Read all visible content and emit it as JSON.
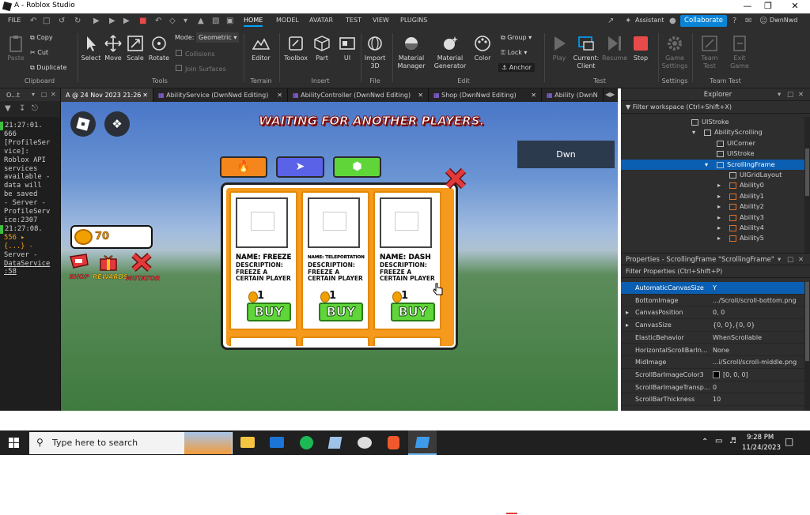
{
  "window": {
    "title": "A - Roblox Studio",
    "controls": [
      "—",
      "❐",
      "✕"
    ]
  },
  "menu": {
    "items": [
      "FILE",
      "HOME",
      "MODEL",
      "AVATAR",
      "TEST",
      "VIEW",
      "PLUGINS"
    ],
    "active": "HOME",
    "assistant": "Assistant",
    "collaborate": "Collaborate",
    "user": "DwnNwd"
  },
  "ribbon": {
    "clipboard": {
      "paste": "Paste",
      "copy": "Copy",
      "cut": "Cut",
      "duplicate": "Duplicate",
      "label": "Clipboard"
    },
    "tools": {
      "select": "Select",
      "move": "Move",
      "scale": "Scale",
      "rotate": "Rotate",
      "mode_label": "Mode:",
      "mode_value": "Geometric",
      "collisions": "Collisions",
      "join_surfaces": "Join Surfaces",
      "label": "Tools"
    },
    "terrain": {
      "editor": "Editor",
      "label": "Terrain"
    },
    "insert": {
      "toolbox": "Toolbox",
      "part": "Part",
      "ui": "UI",
      "label": "Insert"
    },
    "file": {
      "import3d_1": "Import",
      "import3d_2": "3D",
      "label": "File"
    },
    "edit": {
      "material_manager_1": "Material",
      "material_manager_2": "Manager",
      "material_generator_1": "Material",
      "material_generator_2": "Generator",
      "color": "Color",
      "group": "Group",
      "lock": "Lock",
      "anchor": "Anchor",
      "label": "Edit"
    },
    "test": {
      "play": "Play",
      "current_client_1": "Current:",
      "current_client_2": "Client",
      "resume": "Resume",
      "stop": "Stop",
      "label": "Test"
    },
    "settings": {
      "game_settings_1": "Game",
      "game_settings_2": "Settings",
      "label": "Settings"
    },
    "team_test": {
      "team_test_1": "Team",
      "team_test_2": "Test",
      "exit_game_1": "Exit",
      "exit_game_2": "Game",
      "label": "Team Test"
    }
  },
  "output": {
    "title": "O...t",
    "lines": [
      "21:27:01.",
      "666",
      "[ProfileSer",
      "vice]:",
      "Roblox API",
      "services",
      "available -",
      "data will",
      "be saved",
      "- Server -",
      "ProfileServ",
      "ice:2307",
      "21:27:08.",
      "556  ▸",
      "{...}  -",
      "Server -",
      "DataService",
      ":58"
    ]
  },
  "tabs": [
    "A @ 24 Nov 2023 21:26",
    "AbilityService (DwnNwd Editing)",
    "AbilityController (DwnNwd Editing)",
    "Shop (DwnNwd Editing)",
    "Ability (DwnN"
  ],
  "game": {
    "waiting": "WAITING FOR ANOTHER PLAYERS.",
    "player_name": "Dwn",
    "coins": "70",
    "shop": "SHOP",
    "rewards": "REWARDS",
    "mutator": "MUTATOR",
    "cards": [
      {
        "name": "NAME: FREEZE",
        "desc": "DESCRIPTION: FREEZE A CERTAIN PLAYER",
        "price": "1",
        "buy": "BUY"
      },
      {
        "name": "NAME: TELEPORTATION",
        "desc": "DESCRIPTION: FREEZE A CERTAIN PLAYER",
        "price": "1",
        "buy": "BUY"
      },
      {
        "name": "NAME: DASH",
        "desc": "DESCRIPTION: FREEZE A CERTAIN PLAYER",
        "price": "1",
        "buy": "BUY"
      }
    ]
  },
  "explorer": {
    "title": "Explorer",
    "filter": "Filter workspace (Ctrl+Shift+X)",
    "items": [
      {
        "label": "UIStroke",
        "indent": 92,
        "arrow": ""
      },
      {
        "label": "AbilityScrolling",
        "indent": 108,
        "arrow": "▾"
      },
      {
        "label": "UICorner",
        "indent": 124,
        "arrow": ""
      },
      {
        "label": "UIStroke",
        "indent": 124,
        "arrow": ""
      },
      {
        "label": "ScrollingFrame",
        "indent": 124,
        "arrow": "▾",
        "selected": true
      },
      {
        "label": "UIGridLayout",
        "indent": 140,
        "arrow": ""
      },
      {
        "label": "Ability0",
        "indent": 140,
        "arrow": "▸"
      },
      {
        "label": "Ability1",
        "indent": 140,
        "arrow": "▸"
      },
      {
        "label": "Ability2",
        "indent": 140,
        "arrow": "▸"
      },
      {
        "label": "Ability3",
        "indent": 140,
        "arrow": "▸"
      },
      {
        "label": "Ability4",
        "indent": 140,
        "arrow": "▸"
      },
      {
        "label": "Ability5",
        "indent": 140,
        "arrow": "▸"
      }
    ]
  },
  "properties": {
    "title": "Properties - ScrollingFrame \"ScrollingFrame\"",
    "filter": "Filter Properties (Ctrl+Shift+P)",
    "rows": [
      {
        "name": "AutomaticCanvasSize",
        "value": "Y",
        "selected": true
      },
      {
        "name": "BottomImage",
        "value": ".../Scroll/scroll-bottom.png"
      },
      {
        "name": "CanvasPosition",
        "value": "0, 0",
        "arrow": "▸"
      },
      {
        "name": "CanvasSize",
        "value": "{0, 0},{0, 0}",
        "arrow": "▸"
      },
      {
        "name": "ElasticBehavior",
        "value": "WhenScrollable"
      },
      {
        "name": "HorizontalScrollBarIn...",
        "value": "None"
      },
      {
        "name": "MidImage",
        "value": "...i/Scroll/scroll-middle.png"
      },
      {
        "name": "ScrollBarImageColor3",
        "value": "[0, 0, 0]",
        "swatch": "#000000"
      },
      {
        "name": "ScrollBarImageTransp...",
        "value": "0"
      },
      {
        "name": "ScrollBarThickness",
        "value": "10"
      }
    ]
  },
  "taskbar": {
    "search_placeholder": "Type here to search",
    "time": "9:28 PM",
    "date": "11/24/2023"
  },
  "colors": {
    "accent": "#00a2ff",
    "collaborate": "#0a84d6",
    "selection": "#0b5fb3",
    "stop": "#e84a4a",
    "orange": "#f59a1c",
    "buy": "#5fd53a"
  }
}
